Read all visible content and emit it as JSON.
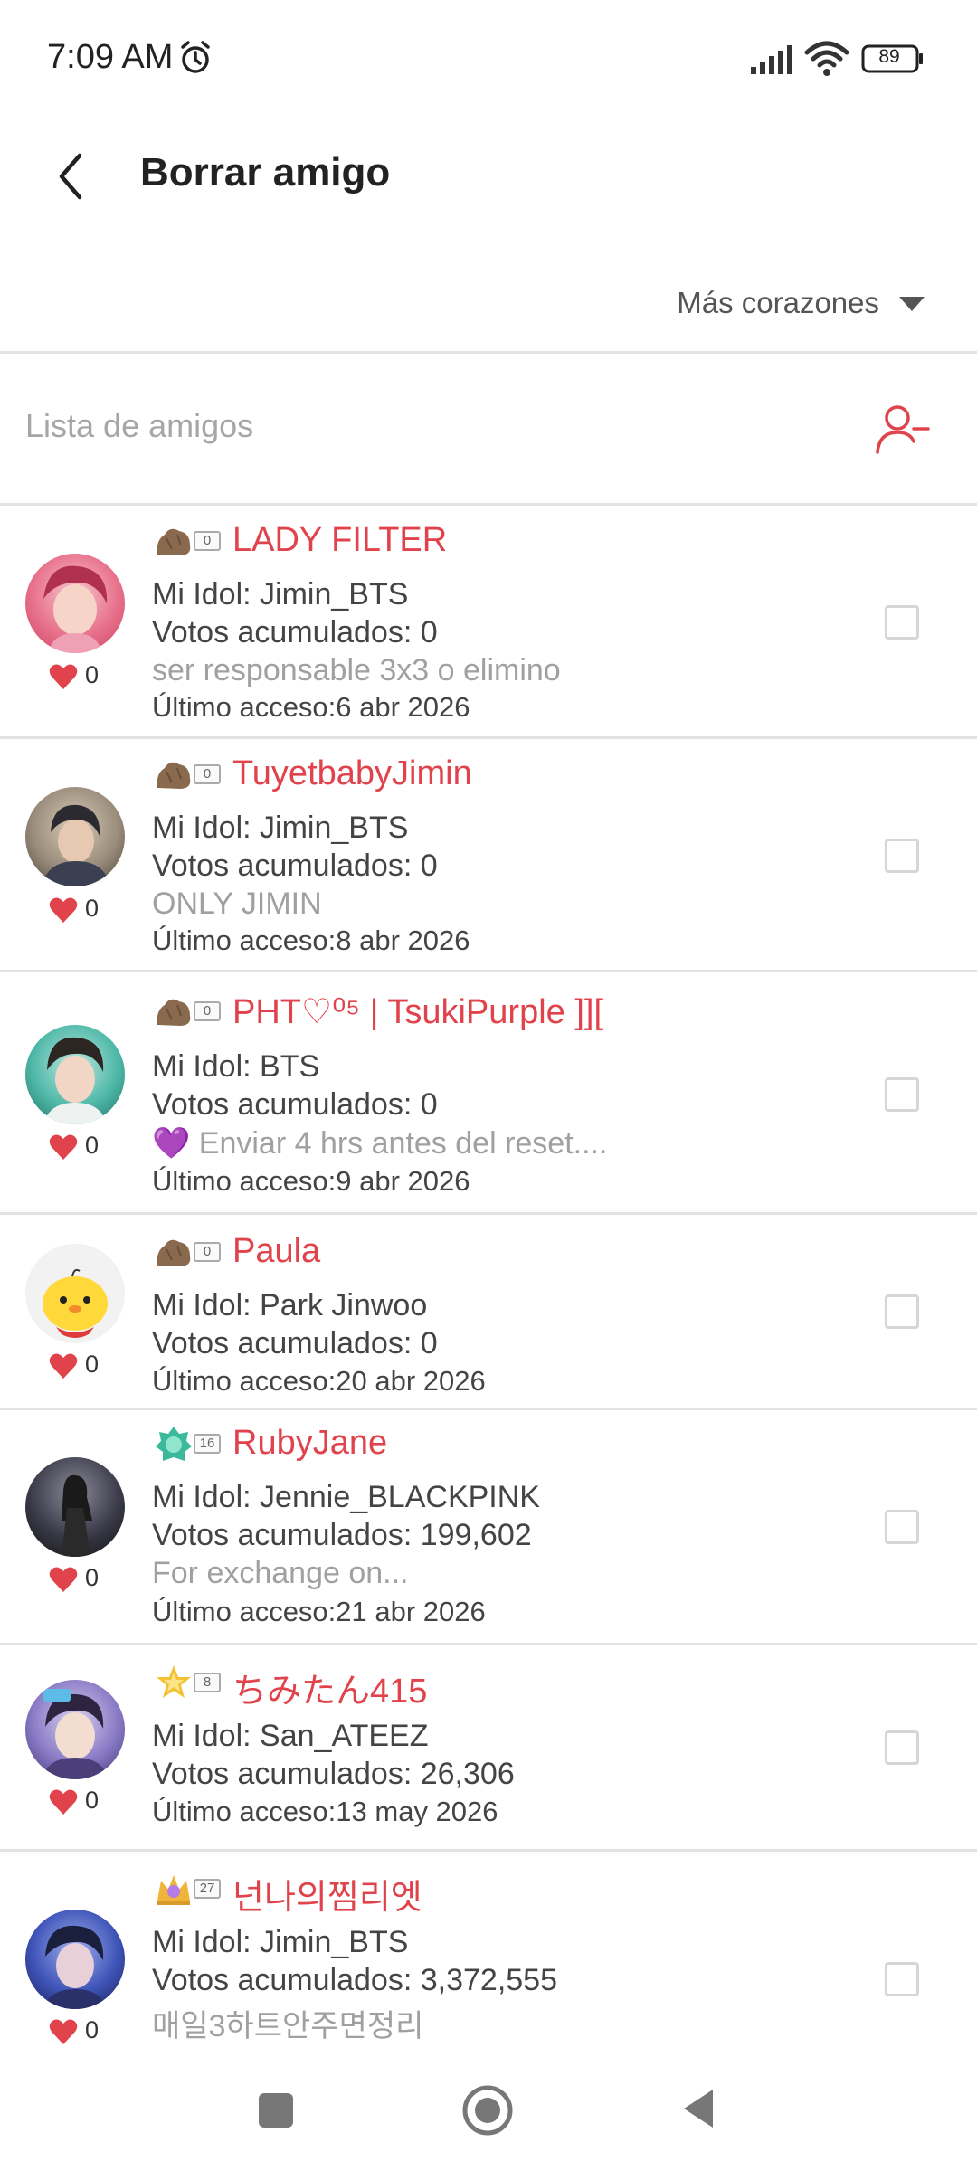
{
  "status_bar": {
    "time": "7:09 AM",
    "battery": "89"
  },
  "header": {
    "title": "Borrar amigo"
  },
  "sort": {
    "label": "Más corazones"
  },
  "list": {
    "label": "Lista de amigos"
  },
  "colors": {
    "accent": "#e0434c",
    "muted": "#a0a0a0",
    "divider": "#e2e2e2"
  },
  "friends": [
    {
      "badge_level": "0",
      "name": "LADY FILTER",
      "idol": "Mi Idol: Jimin_BTS",
      "votes": "Votos acumulados: 0",
      "status": "ser responsable 3x3 o elimino",
      "last_access": "Último acceso:6 abr 2026",
      "hearts": "0"
    },
    {
      "badge_level": "0",
      "name": "TuyetbabyJimin",
      "idol": "Mi Idol: Jimin_BTS",
      "votes": "Votos acumulados: 0",
      "status": "ONLY JIMIN",
      "last_access": "Último acceso:8 abr 2026",
      "hearts": "0"
    },
    {
      "badge_level": "0",
      "name": "PHT♡⁰⁵ | TsukiPurple ]][",
      "idol": "Mi Idol: BTS",
      "votes": "Votos acumulados: 0",
      "status": "💜 Enviar 4 hrs antes del reset....",
      "last_access": "Último acceso:9 abr 2026",
      "hearts": "0"
    },
    {
      "badge_level": "0",
      "name": "Paula",
      "idol": "Mi Idol: Park Jinwoo",
      "votes": "Votos acumulados: 0",
      "last_access": "Último acceso:20 abr 2026",
      "hearts": "0"
    },
    {
      "badge_level": "16",
      "name": "RubyJane",
      "idol": "Mi Idol: Jennie_BLACKPINK",
      "votes": "Votos acumulados: 199,602",
      "status": "For exchange on...",
      "last_access": "Último acceso:21 abr 2026",
      "hearts": "0"
    },
    {
      "badge_level": "8",
      "name": "ちみたん415",
      "idol": "Mi Idol: San_ATEEZ",
      "votes": "Votos acumulados: 26,306",
      "last_access": "Último acceso:13 may 2026",
      "hearts": "0"
    },
    {
      "badge_level": "27",
      "name": "넌나의찜리엣",
      "idol": "Mi Idol: Jimin_BTS",
      "votes": "Votos acumulados: 3,372,555",
      "status": "매일3하트안주면정리",
      "hearts": "0"
    }
  ]
}
